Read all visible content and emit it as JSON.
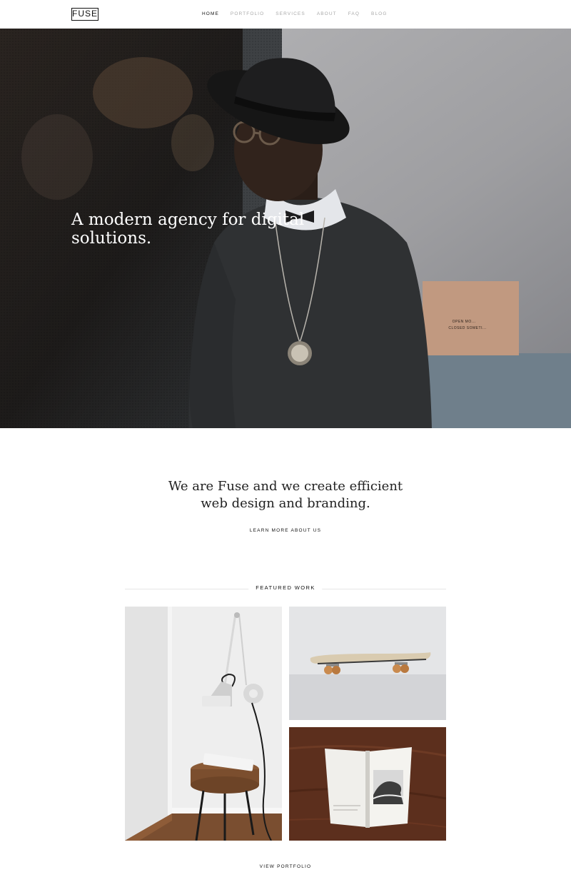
{
  "header": {
    "logo": "FUSE",
    "nav": [
      {
        "label": "HOME",
        "active": true
      },
      {
        "label": "PORTFOLIO",
        "active": false
      },
      {
        "label": "SERVICES",
        "active": false
      },
      {
        "label": "ABOUT",
        "active": false
      },
      {
        "label": "FAQ",
        "active": false
      },
      {
        "label": "BLOG",
        "active": false
      }
    ]
  },
  "hero": {
    "title": "A modern agency for digital solutions.",
    "sign_line_1": "OPEN MO...",
    "sign_line_2": "CLOSED SOMETI..."
  },
  "intro": {
    "text": "We are Fuse and we create efficient web design and branding.",
    "link": "LEARN MORE ABOUT US"
  },
  "featured": {
    "heading": "FEATURED WORK",
    "link": "VIEW PORTFOLIO"
  }
}
